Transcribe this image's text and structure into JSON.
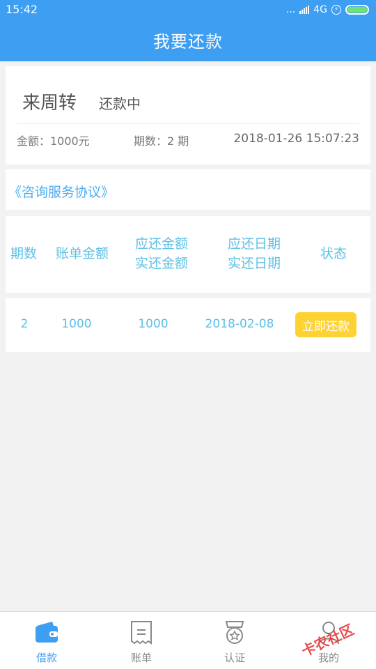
{
  "status_bar": {
    "time": "15:42",
    "dots": "...",
    "network": "4G"
  },
  "header": {
    "title": "我要还款"
  },
  "loan": {
    "name": "来周转",
    "status": "还款中",
    "amount": "金额：1000元",
    "periods": "期数：2 期",
    "datetime": "2018-01-26 15:07:23"
  },
  "agreement": {
    "link": "《咨询服务协议》"
  },
  "table": {
    "headers": {
      "period": "期数",
      "bill_amount": "账单金额",
      "due_amount": "应还金额",
      "paid_amount": "实还金额",
      "due_date": "应还日期",
      "paid_date": "实还日期",
      "status": "状态"
    },
    "rows": [
      {
        "period": "2",
        "bill_amount": "1000",
        "due_amount": "1000",
        "due_date": "2018-02-08",
        "action": "立即还款"
      }
    ]
  },
  "tabs": [
    {
      "label": "借款",
      "icon": "wallet-icon",
      "active": true
    },
    {
      "label": "账单",
      "icon": "receipt-icon",
      "active": false
    },
    {
      "label": "认证",
      "icon": "badge-icon",
      "active": false
    },
    {
      "label": "我的",
      "icon": "user-icon",
      "active": false
    }
  ],
  "watermark": "卡农社区",
  "colors": {
    "primary": "#3d9ef2",
    "table_text": "#5bc0e6",
    "button": "#ffd233",
    "background": "#f2f2f2"
  }
}
